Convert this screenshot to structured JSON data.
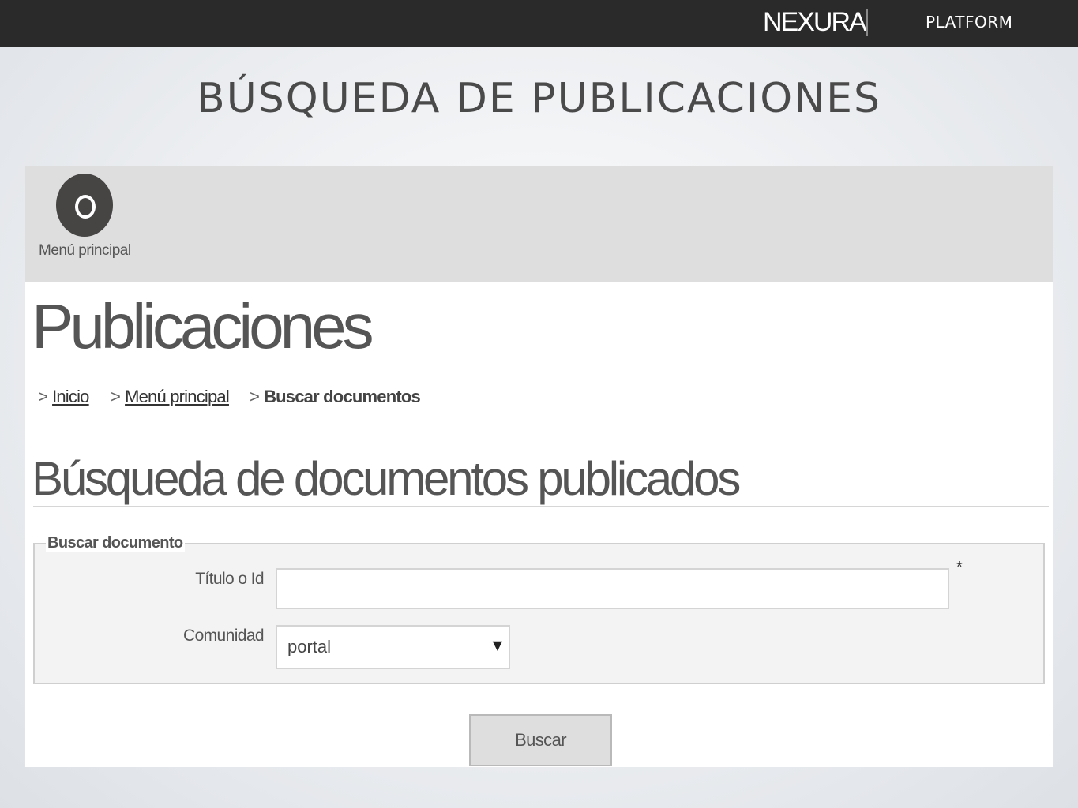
{
  "header": {
    "logo_text": "NEXURA",
    "platform_label": "PLATFORM",
    "background": "#2a2a2a"
  },
  "slide": {
    "title": "BÚSQUEDA DE PUBLICACIONES"
  },
  "app": {
    "menu": {
      "icon": "menu-circle-icon",
      "label": "Menú principal"
    },
    "page_title": "Publicaciones",
    "breadcrumb": [
      {
        "label": "Inicio",
        "link": true
      },
      {
        "label": "Menú principal",
        "link": true
      },
      {
        "label": "Buscar documentos",
        "link": false
      }
    ],
    "section_title": "Búsqueda de documentos publicados",
    "form": {
      "legend": "Buscar documento",
      "title_field": {
        "label": "Título o Id",
        "value": "",
        "required_mark": "*"
      },
      "community_field": {
        "label": "Comunidad",
        "selected": "portal"
      },
      "submit_label": "Buscar"
    }
  }
}
